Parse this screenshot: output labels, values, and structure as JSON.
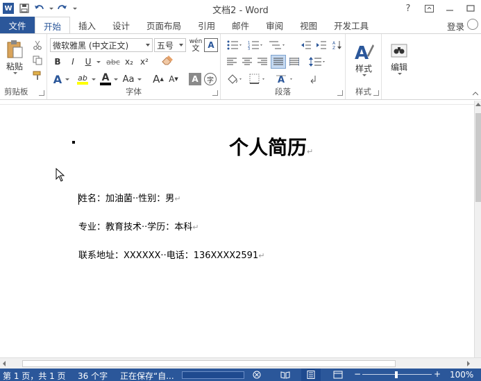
{
  "window": {
    "title": "文档2 - Word",
    "app_icon": "W",
    "controls": {
      "help": "?",
      "restore_ribbon": "⧉",
      "minimize": "—",
      "maximize": "☐"
    }
  },
  "tabs": [
    {
      "label": "文件"
    },
    {
      "label": "开始"
    },
    {
      "label": "插入"
    },
    {
      "label": "设计"
    },
    {
      "label": "页面布局"
    },
    {
      "label": "引用"
    },
    {
      "label": "邮件"
    },
    {
      "label": "审阅"
    },
    {
      "label": "视图"
    },
    {
      "label": "开发工具"
    }
  ],
  "account": {
    "login_label": "登录"
  },
  "ribbon": {
    "clipboard": {
      "label": "剪贴板",
      "paste_label": "粘贴"
    },
    "font": {
      "label": "字体",
      "font_name": "微软雅黑 (中文正文)",
      "font_size": "五号",
      "bold": "B",
      "italic": "I",
      "underline": "U",
      "strike": "abc",
      "subscript": "x₂",
      "superscript": "x²",
      "text_effects": "A",
      "highlight": "ab",
      "font_color": "A",
      "change_case": "Aa",
      "grow": "A",
      "shrink": "A",
      "clear": "A",
      "char_shading": "A",
      "enclose": "字",
      "phonetic": "wén"
    },
    "paragraph": {
      "label": "段落"
    },
    "styles": {
      "label": "样式",
      "styles_label": "样式"
    },
    "editing": {
      "editing_label": "编辑"
    }
  },
  "document": {
    "title": "个人简历",
    "lines": [
      "姓名：加油菌··性别：男",
      "专业：教育技术··学历：本科",
      "联系地址：XXXXXX··电话：136XXXX2591"
    ],
    "paragraph_mark": "↵"
  },
  "statusbar": {
    "page": "第 1 页，共 1 页",
    "words": "36 个字",
    "saving": "正在保存“自...",
    "zoom": "100%",
    "zoom_minus": "−",
    "zoom_plus": "+"
  }
}
